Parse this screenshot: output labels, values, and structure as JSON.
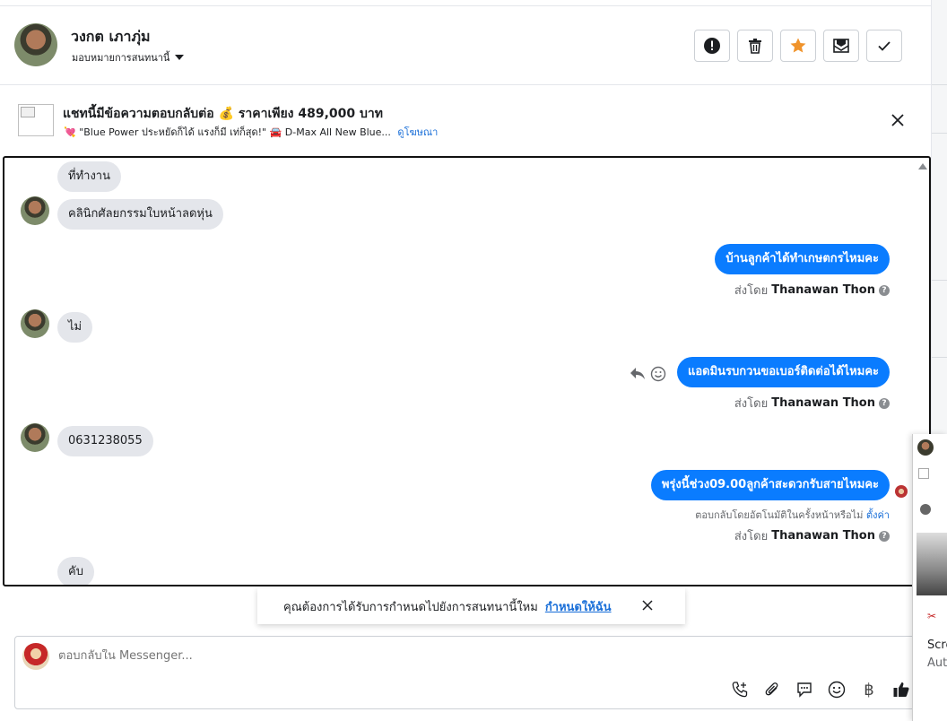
{
  "header": {
    "name": "วงกต เภาภุ่ม",
    "assign_label": "มอบหมายการสนทนานี้"
  },
  "ad": {
    "title": "แชทนี้มีข้อความตอบกลับต่อ 💰 ราคาเพียง 489,000 บาท",
    "subtitle": "💘 \"Blue Power ประหยัดก็ได้ แรงก็มี เท่ก็สุด!\" 🚘 D-Max All New Blue...",
    "view_ad_link": "ดูโฆษณา"
  },
  "messages": {
    "m1": "ที่ทำงาน",
    "m2": "คลินิกศัลยกรรมใบหน้าลดหุ่น",
    "m3": "บ้านลูกค้าได้ทำเกษตกรไหมคะ",
    "m4": "ไม่",
    "m5": "แอดมินรบกวนขอเบอร์ติดต่อได้ไหมคะ",
    "m6": "0631238055",
    "m7": "พรุ่งนี้ช่วง09.00ลูกค้าสะดวกรับสายไหมคะ",
    "m8": "คับ"
  },
  "sent_by": {
    "prefix": "ส่งโดย",
    "agent": "Thanawan Thon",
    "help": "?"
  },
  "auto_reply": {
    "text": "ตอบกลับโดยอัตโนมัติในครั้งหน้าหรือไม่",
    "link": "ตั้งค่า"
  },
  "toast": {
    "text": "คุณต้องการได้รับการกำหนดไปยังการสนทนานี้ใหม",
    "link": "กำหนดให้ฉัน"
  },
  "composer": {
    "placeholder": "ตอบกลับใน Messenger...",
    "baht_symbol": "฿"
  },
  "side_panel": {
    "title_partial": "Scre",
    "sub_partial": "Aut"
  },
  "colors": {
    "outgoing": "#0a7cff",
    "incoming": "#e4e6eb",
    "star": "#f0932b",
    "link": "#1a6fd8"
  }
}
